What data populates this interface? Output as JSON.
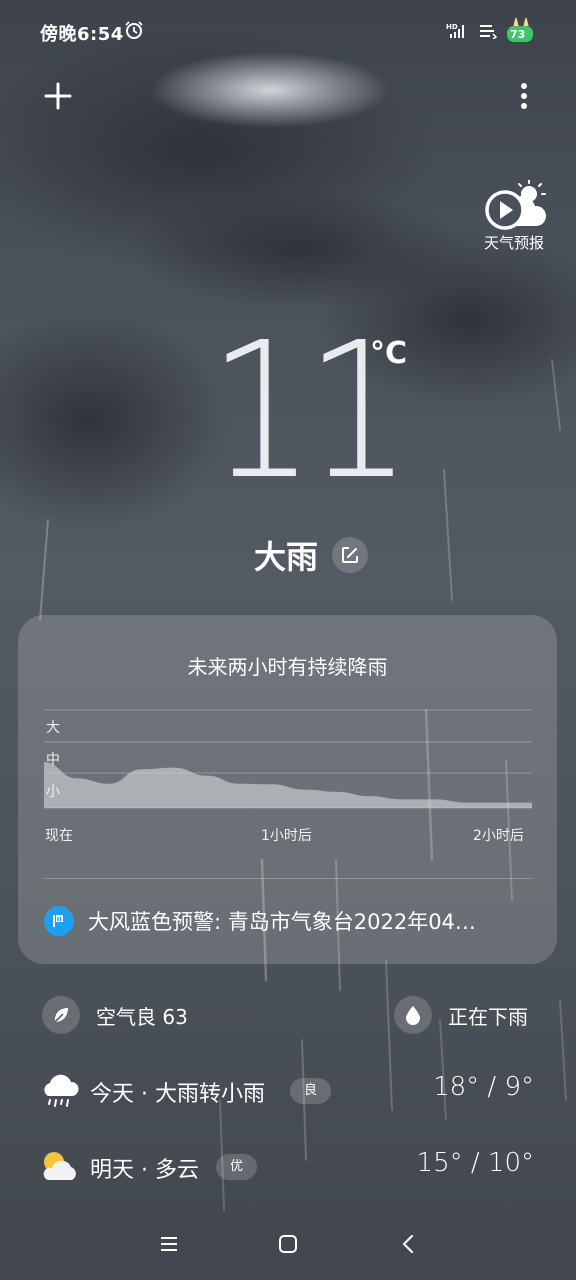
{
  "status_bar": {
    "time": "傍晚6:54",
    "battery_level": "73",
    "icons": [
      "alarm-icon",
      "hd-signal-icon",
      "network-speed-icon",
      "battery-icon"
    ]
  },
  "toolbar": {
    "add_icon": "plus-icon",
    "more_icon": "more-vertical-icon"
  },
  "video_forecast": {
    "label": "天气预报",
    "icon": "play-cloud-sun-icon"
  },
  "current": {
    "temperature": "11",
    "unit": "°C",
    "condition": "大雨"
  },
  "precipitation_card": {
    "title": "未来两小时有持续降雨",
    "y_labels": [
      "大",
      "中",
      "小"
    ],
    "x_labels": [
      "现在",
      "1小时后",
      "2小时后"
    ],
    "intensity_levels": [
      0.85,
      0.55,
      0.45,
      0.72,
      0.75,
      0.6,
      0.45,
      0.44,
      0.34,
      0.3,
      0.22,
      0.16,
      0.16,
      0.1,
      0.1,
      0.1
    ],
    "alert_text": "大风蓝色预警: 青岛市气象台2022年04…",
    "alert_color": "#1da0ef"
  },
  "quick_info": {
    "air_quality": "空气良 63",
    "rain_status": "正在下雨"
  },
  "forecast": [
    {
      "day": "今天 · 大雨转小雨",
      "badge": "良",
      "range": "18° / 9°",
      "icon": "rain-cloud-icon"
    },
    {
      "day": "明天 · 多云",
      "badge": "优",
      "range": "15° / 10°",
      "icon": "partly-cloudy-icon"
    }
  ]
}
